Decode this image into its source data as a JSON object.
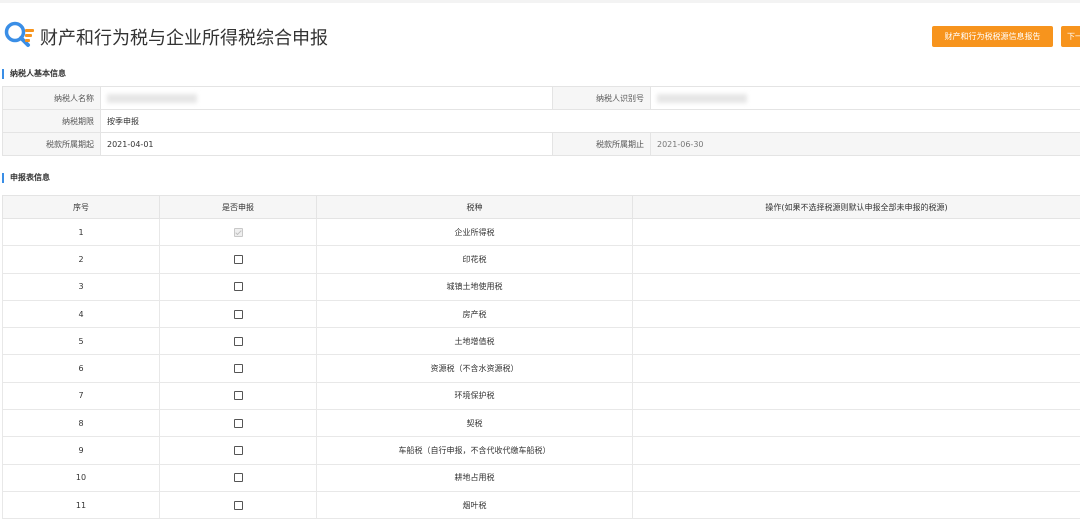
{
  "page": {
    "title": "财产和行为税与企业所得税综合申报",
    "buttons": {
      "report": "财产和行为税税源信息报告",
      "next": "下一"
    }
  },
  "basic_info": {
    "section_title": "纳税人基本信息",
    "taxpayer_name_label": "纳税人名称",
    "taxpayer_name_value": "",
    "taxpayer_id_label": "纳税人识别号",
    "taxpayer_id_value": "",
    "tax_period_label": "纳税期限",
    "tax_period_value": "按季申报",
    "period_start_label": "税款所属期起",
    "period_start_value": "2021-04-01",
    "period_end_label": "税款所属期止",
    "period_end_value": "2021-06-30"
  },
  "declaration": {
    "section_title": "申报表信息",
    "columns": [
      "序号",
      "是否申报",
      "税种",
      "操作(如果不选择税源则默认申报全部未申报的税源)"
    ],
    "rows": [
      {
        "no": "1",
        "tax": "企业所得税",
        "checked": true,
        "disabled": true
      },
      {
        "no": "2",
        "tax": "印花税",
        "checked": false,
        "disabled": false
      },
      {
        "no": "3",
        "tax": "城镇土地使用税",
        "checked": false,
        "disabled": false
      },
      {
        "no": "4",
        "tax": "房产税",
        "checked": false,
        "disabled": false
      },
      {
        "no": "5",
        "tax": "土地增值税",
        "checked": false,
        "disabled": false
      },
      {
        "no": "6",
        "tax": "资源税（不含水资源税）",
        "checked": false,
        "disabled": false
      },
      {
        "no": "7",
        "tax": "环境保护税",
        "checked": false,
        "disabled": false
      },
      {
        "no": "8",
        "tax": "契税",
        "checked": false,
        "disabled": false
      },
      {
        "no": "9",
        "tax": "车船税（自行申报，不含代收代缴车船税）",
        "checked": false,
        "disabled": false
      },
      {
        "no": "10",
        "tax": "耕地占用税",
        "checked": false,
        "disabled": false
      },
      {
        "no": "11",
        "tax": "烟叶税",
        "checked": false,
        "disabled": false
      }
    ]
  },
  "colors": {
    "accent_orange": "#f7941d",
    "section_bar_blue": "#3a8ee6",
    "logo_blue": "#3a8ee6",
    "logo_orange": "#f7941d"
  },
  "icons": {
    "logo": "search-magnifier-icon"
  }
}
